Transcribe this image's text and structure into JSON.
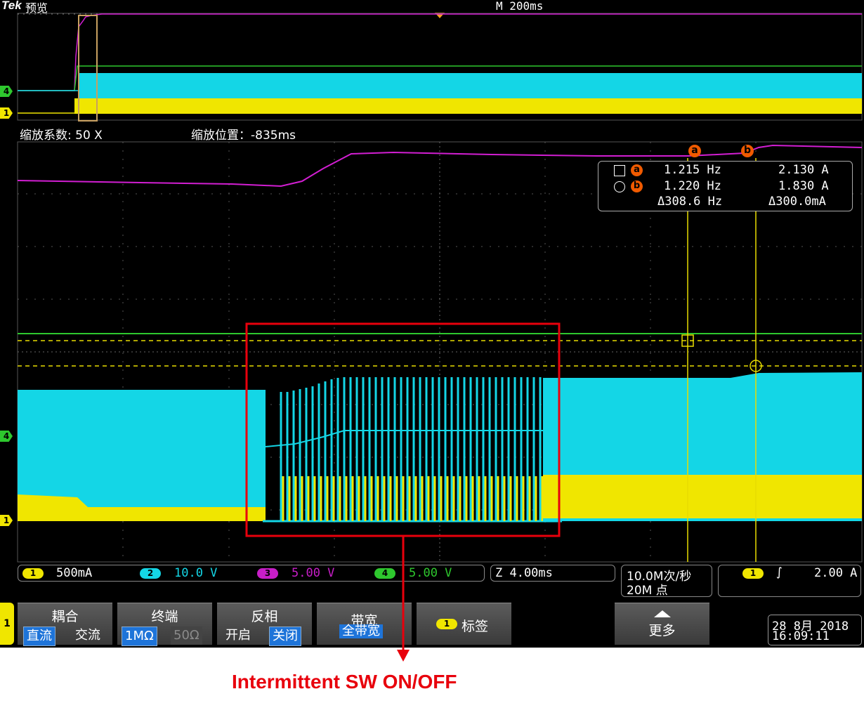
{
  "header": {
    "brand": "Tek",
    "mode": "预览",
    "timebase": "M 200ms"
  },
  "zoom": {
    "factor_label": "缩放系数: 50 X",
    "position_label": "缩放位置：-835ms"
  },
  "cursor_panel": {
    "a_freq": "1.215 Hz",
    "a_amp": "2.130 A",
    "b_freq": "1.220 Hz",
    "b_amp": "1.830 A",
    "delta_freq": "Δ308.6 Hz",
    "delta_amp": "Δ300.0mA",
    "a_label": "a",
    "b_label": "b"
  },
  "channels": [
    {
      "num": "1",
      "scale": "500mA",
      "color": "#f0e600"
    },
    {
      "num": "2",
      "scale": "10.0 V",
      "color": "#14d6e6"
    },
    {
      "num": "3",
      "scale": "5.00 V",
      "color": "#c81ec8"
    },
    {
      "num": "4",
      "scale": "5.00 V",
      "color": "#2ec82e"
    }
  ],
  "markers": {
    "ch4": "4",
    "ch1": "1"
  },
  "acquisition": {
    "zoom_time": "Z 4.00ms",
    "sample_rate": "10.0M次/秒",
    "record_length": "20M 点"
  },
  "trigger": {
    "channel": "1",
    "slope": "∫",
    "level": "2.00 A"
  },
  "menu": {
    "channel_tab": "1",
    "coupling": {
      "title": "耦合",
      "dc": "直流",
      "ac": "交流"
    },
    "termination": {
      "title": "终端",
      "one_meg": "1MΩ",
      "fifty": "50Ω"
    },
    "invert": {
      "title": "反相",
      "on": "开启",
      "off": "关闭"
    },
    "bandwidth": {
      "title": "带宽",
      "value": "全带宽"
    },
    "label": {
      "num": "1",
      "text": "标签"
    },
    "more": "更多"
  },
  "datetime": {
    "date": "28 8月 2018",
    "time": "16:09:11"
  },
  "annotation": "Intermittent  SW ON/OFF",
  "colors": {
    "yellow": "#f0e600",
    "cyan": "#14d6e6",
    "magenta": "#d21ed2",
    "green": "#2ec82e",
    "red": "#e8000c"
  }
}
